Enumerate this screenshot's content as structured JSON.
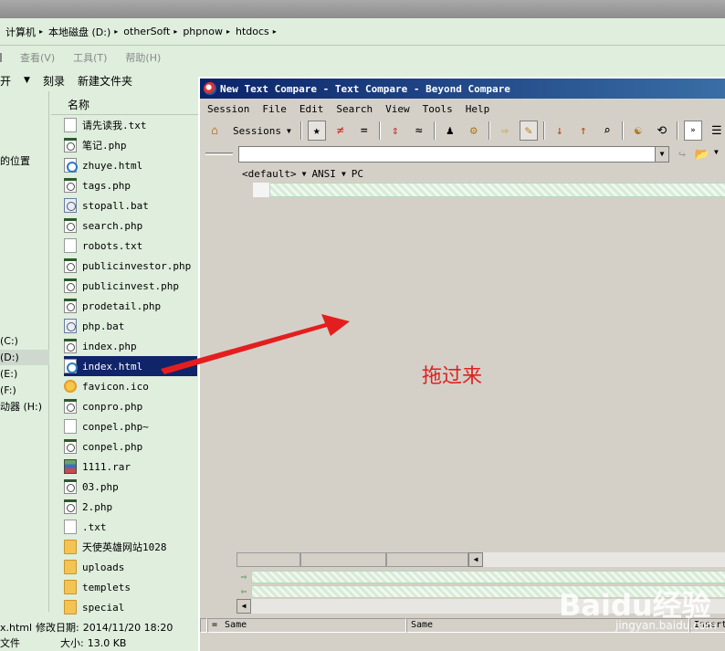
{
  "explorer": {
    "breadcrumb": [
      "计算机",
      "本地磁盘 (D:)",
      "otherSoft",
      "phpnow",
      "htdocs"
    ],
    "menu": [
      "查看(V)",
      "工具(T)",
      "帮助(H)"
    ],
    "toolbar": {
      "open": "开",
      "burn": "刻录",
      "new_folder": "新建文件夹"
    },
    "nav": {
      "location": "的位置",
      "drive_c": "(C:)",
      "drive_d": "(D:)",
      "drive_e": "(E:)",
      "drive_f": "(F:)",
      "drive_h": "动器 (H:)"
    },
    "column_header": "名称",
    "files": [
      {
        "name": "请先读我.txt",
        "type": "txt"
      },
      {
        "name": "笔记.php",
        "type": "php"
      },
      {
        "name": "zhuye.html",
        "type": "html"
      },
      {
        "name": "tags.php",
        "type": "php"
      },
      {
        "name": "stopall.bat",
        "type": "bat"
      },
      {
        "name": "search.php",
        "type": "php"
      },
      {
        "name": "robots.txt",
        "type": "txt"
      },
      {
        "name": "publicinvestor.php",
        "type": "php"
      },
      {
        "name": "publicinvest.php",
        "type": "php"
      },
      {
        "name": "prodetail.php",
        "type": "php"
      },
      {
        "name": "php.bat",
        "type": "bat"
      },
      {
        "name": "index.php",
        "type": "php"
      },
      {
        "name": "index.html",
        "type": "html",
        "selected": true
      },
      {
        "name": "favicon.ico",
        "type": "ico"
      },
      {
        "name": "conpro.php",
        "type": "php"
      },
      {
        "name": "conpel.php~",
        "type": "txt"
      },
      {
        "name": "conpel.php",
        "type": "php"
      },
      {
        "name": "1111.rar",
        "type": "rar"
      },
      {
        "name": "03.php",
        "type": "php"
      },
      {
        "name": "2.php",
        "type": "php"
      },
      {
        "name": ".txt",
        "type": "txt"
      },
      {
        "name": "天使英雄网站1028",
        "type": "folder"
      },
      {
        "name": "uploads",
        "type": "folder"
      },
      {
        "name": "templets",
        "type": "folder"
      },
      {
        "name": "special",
        "type": "folder"
      }
    ],
    "status": {
      "file_name": "x.html",
      "modified_label": "修改日期:",
      "modified_value": "2014/11/20 18:20",
      "type_label": "文件",
      "size_label": "大小:",
      "size_value": "13.0 KB"
    }
  },
  "beyond_compare": {
    "title": "New Text Compare - Text Compare - Beyond Compare",
    "menu": [
      "Session",
      "File",
      "Edit",
      "Search",
      "View",
      "Tools",
      "Help"
    ],
    "sessions_label": "Sessions",
    "format": {
      "rules": "<default>",
      "encoding": "ANSI",
      "line_endings": "PC"
    },
    "path_value": "",
    "status": {
      "left": "Same",
      "middle": "Same",
      "right": "Insert"
    }
  },
  "annotation": "拖过来",
  "watermark": {
    "brand": "Baidu经验",
    "url": "jingyan.baidu.com"
  },
  "colors": {
    "explorer_bg": "#dfeedd",
    "selection": "#10246a",
    "titlebar": "#0a246a",
    "annotation": "#e02020"
  }
}
